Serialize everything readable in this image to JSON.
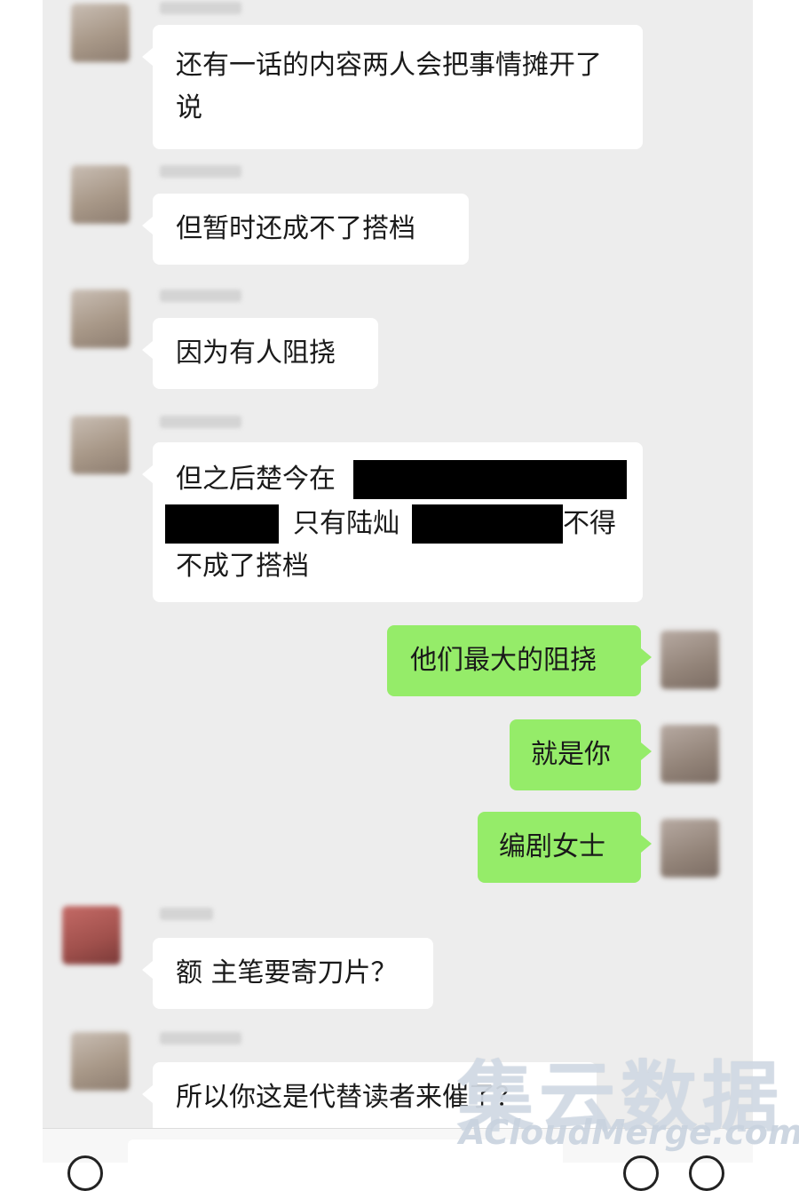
{
  "messages": [
    {
      "sender": "other",
      "text": "还有一话的内容两人会把事情摊开了说"
    },
    {
      "sender": "other",
      "text": "但暂时还成不了搭档"
    },
    {
      "sender": "other",
      "text": "因为有人阻挠"
    },
    {
      "sender": "other",
      "line1": "但之后楚今在",
      "line2a": "只有陆灿",
      "line2b": "不得",
      "line3": "不成了搭档"
    },
    {
      "sender": "me",
      "text": "他们最大的阻挠"
    },
    {
      "sender": "me",
      "text": "就是你"
    },
    {
      "sender": "me",
      "text": "编剧女士"
    },
    {
      "sender": "other",
      "text": "额 主笔要寄刀片？"
    },
    {
      "sender": "other",
      "text": "所以你这是代替读者来催了？"
    }
  ],
  "watermark": {
    "cn": "集云数据",
    "en": "ACloudMerge.com"
  },
  "colors": {
    "background": "#ededed",
    "incoming": "#ffffff",
    "outgoing": "#95ec69"
  },
  "icons": [
    "avatar",
    "voice-icon",
    "emoji-icon",
    "add-icon"
  ]
}
